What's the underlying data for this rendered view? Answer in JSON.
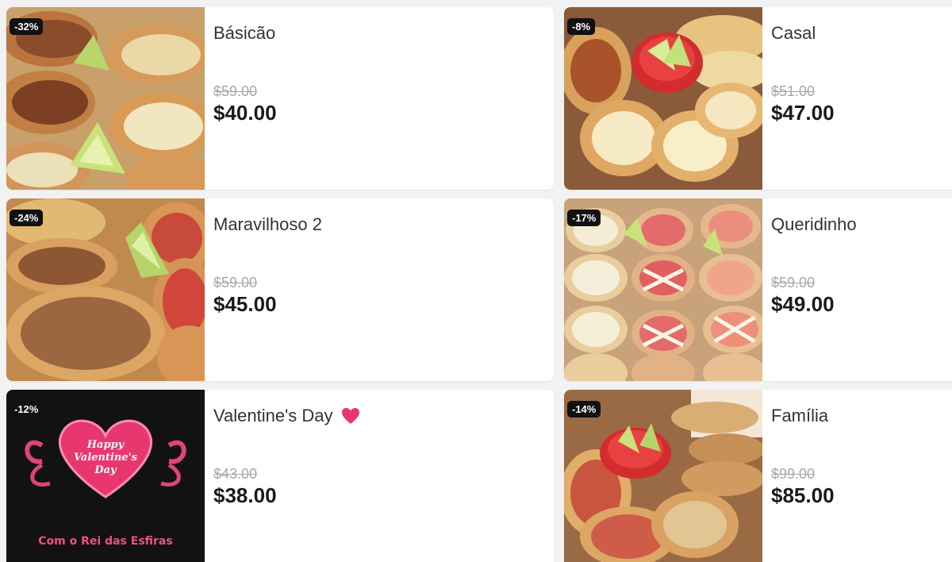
{
  "products": [
    {
      "name": "Básicão",
      "badge": "-32%",
      "old_price": "$59.00",
      "price": "$40.00"
    },
    {
      "name": "Casal",
      "badge": "-8%",
      "old_price": "$51.00",
      "price": "$47.00"
    },
    {
      "name": "Maravilhoso 2",
      "badge": "-24%",
      "old_price": "$59.00",
      "price": "$45.00"
    },
    {
      "name": "Queridinho",
      "badge": "-17%",
      "old_price": "$59.00",
      "price": "$49.00"
    },
    {
      "name": "Valentine's Day",
      "badge": "-12%",
      "old_price": "$43.00",
      "price": "$38.00",
      "image_text": {
        "heart": "Happy Valentine's Day",
        "footer": "Com o Rei das Esfiras"
      }
    },
    {
      "name": "Família",
      "badge": "-14%",
      "old_price": "$99.00",
      "price": "$85.00"
    }
  ],
  "colors": {
    "badge_bg": "#111111",
    "price": "#1a1a1a",
    "old_price": "#a7a7a7",
    "valentine_pink": "#e8376f"
  }
}
